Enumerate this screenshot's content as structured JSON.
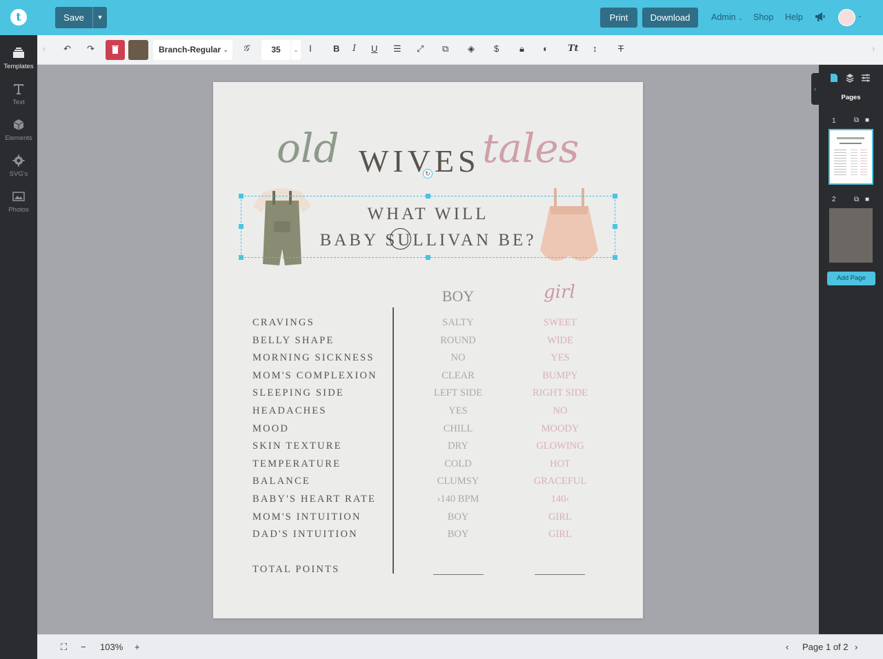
{
  "topbar": {
    "logo": "t",
    "save_label": "Save",
    "print_label": "Print",
    "download_label": "Download",
    "admin_label": "Admin",
    "shop_label": "Shop",
    "help_label": "Help",
    "avatar_icon": "user-avatar-icon"
  },
  "sidebar": {
    "items": [
      {
        "label": "Templates",
        "icon": "templates-icon"
      },
      {
        "label": "Text",
        "icon": "text-icon"
      },
      {
        "label": "Elements",
        "icon": "cube-icon"
      },
      {
        "label": "SVG's",
        "icon": "gear-icon"
      },
      {
        "label": "Photos",
        "icon": "photo-icon"
      }
    ]
  },
  "toolbar": {
    "font_name": "Branch-Regular",
    "font_size": "35",
    "color_swatch": "#6b5a4a"
  },
  "right_panel": {
    "label": "Pages",
    "page1": "1",
    "page2": "2",
    "add_page_label": "Add Page"
  },
  "bottombar": {
    "zoom": "103%",
    "page_indicator": "Page 1 of 2"
  },
  "document": {
    "title_script_left": "old",
    "title_main": "WIVES",
    "title_script_right": "tales",
    "subtitle_line1": "WHAT WILL",
    "subtitle_line2": "BABY SULLIVAN BE?",
    "col_boy": "BOY",
    "col_girl": "girl",
    "rows": [
      {
        "label": "CRAVINGS",
        "boy": "SALTY",
        "girl": "SWEET"
      },
      {
        "label": "BELLY SHAPE",
        "boy": "ROUND",
        "girl": "WIDE"
      },
      {
        "label": "MORNING SICKNESS",
        "boy": "NO",
        "girl": "YES"
      },
      {
        "label": "MOM'S COMPLEXION",
        "boy": "CLEAR",
        "girl": "BUMPY"
      },
      {
        "label": "SLEEPING SIDE",
        "boy": "LEFT SIDE",
        "girl": "RIGHT SIDE"
      },
      {
        "label": "HEADACHES",
        "boy": "YES",
        "girl": "NO"
      },
      {
        "label": "MOOD",
        "boy": "CHILL",
        "girl": "MOODY"
      },
      {
        "label": "SKIN TEXTURE",
        "boy": "DRY",
        "girl": "GLOWING"
      },
      {
        "label": "TEMPERATURE",
        "boy": "COLD",
        "girl": "HOT"
      },
      {
        "label": "BALANCE",
        "boy": "CLUMSY",
        "girl": "GRACEFUL"
      },
      {
        "label": "BABY'S HEART RATE",
        "boy": "›140 BPM",
        "girl": "140‹"
      },
      {
        "label": "MOM'S INTUITION",
        "boy": "BOY",
        "girl": "GIRL"
      },
      {
        "label": "DAD'S INTUITION",
        "boy": "BOY",
        "girl": "GIRL"
      }
    ],
    "total_label": "TOTAL POINTS"
  },
  "colors": {
    "brand": "#4bc3e1",
    "button": "#2f6e86",
    "delete": "#cf3f52"
  }
}
